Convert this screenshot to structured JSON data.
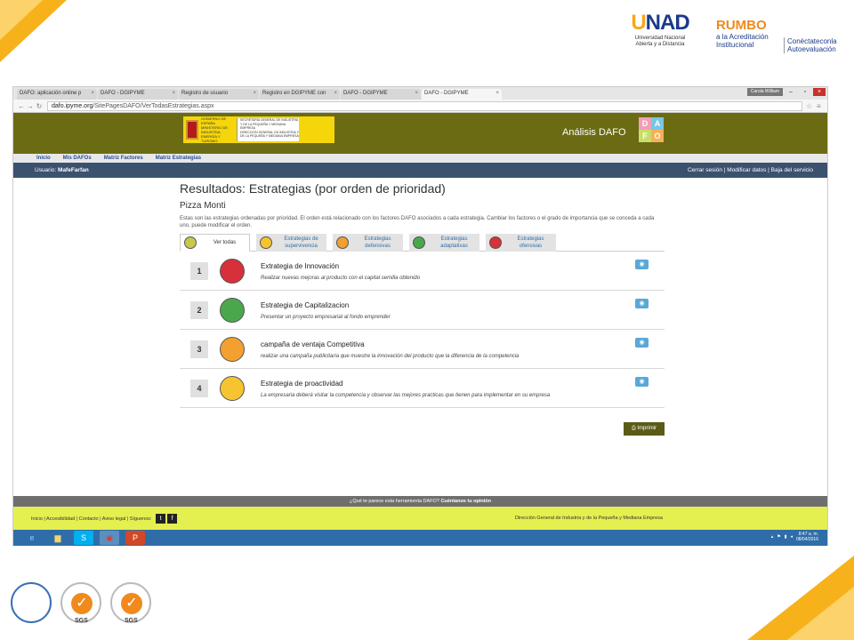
{
  "slide": {
    "unad_logo": {
      "name_letter_u": "U",
      "name_rest": "NAD",
      "line1": "Universidad Nacional",
      "line2": "Abierta y a Distancia"
    },
    "rumbo_logo": {
      "title": "RUMBO",
      "line1": "a la Acreditación",
      "line2": "Institucional",
      "side1": "Conéctateconla",
      "side2": "Autoevaluación"
    },
    "bottom_logos": [
      "SGS",
      "SGS"
    ]
  },
  "browser": {
    "tabs": [
      {
        "label": "DAFO: aplicación online p",
        "active": false
      },
      {
        "label": "DAFO - DGIPYME",
        "active": false
      },
      {
        "label": "Registro de usuario",
        "active": false
      },
      {
        "label": "Registro en DGIPYME con",
        "active": false
      },
      {
        "label": "DAFO - DGIPYME",
        "active": false
      },
      {
        "label": "DAFO - DGIPYME",
        "active": true
      }
    ],
    "user_chip": "Carola William",
    "url": "dafo.ipyme.org",
    "url_path": "/SitePagesDAFO/VerTodasEstrategias.aspx"
  },
  "header": {
    "gov_line1": "GOBIERNO DE ESPAÑA",
    "gov_line2": "MINISTERIO DE INDUSTRIA, ENERGÍA Y TURISMO",
    "gov_line3": "SECRETARÍA GENERAL DE INDUSTRIA Y DE LA PEQUEÑA Y MEDIANA EMPRESA",
    "gov_line4": "DIRECCIÓN GENERAL DE INDUSTRIA Y DE LA PEQUEÑA Y MEDIANA EMPRESA",
    "title": "Análisis DAFO",
    "logo_letters": [
      "D",
      "A",
      "F",
      "O"
    ]
  },
  "menu": [
    "Inicio",
    "Mis DAFOs",
    "Matriz Factores",
    "Matriz Estrategias"
  ],
  "userbar": {
    "user_label": "Usuario:",
    "user_name": "MafeFarfan",
    "links": "Cerrar sesión | Modificar datos | Baja del servicio"
  },
  "content": {
    "title": "Resultados: Estrategias (por orden de prioridad)",
    "company": "Pizza Monti",
    "description": "Estas son las estrategias ordenadas por prioridad. El orden está relacionado con los factores DAFO asociados a cada estrategia. Cambiar los factores o el grado de importancia que se conceda a cada uno, puede modificar el orden.",
    "filter_tabs": [
      {
        "label": "Ver todas",
        "color": "#c8c84a"
      },
      {
        "label": "Estrategias de supervivencia",
        "color": "#f5c430"
      },
      {
        "label": "Estrategias defensivas",
        "color": "#f2a030"
      },
      {
        "label": "Estrategias adaptativas",
        "color": "#4aa84a"
      },
      {
        "label": "Estrategias ofensivas",
        "color": "#d8303a"
      }
    ],
    "strategies": [
      {
        "num": "1",
        "title": "Extrategia de Innovación",
        "subtitle": "Realizar nuevas mejoras al producto con el capital semilla obtenido",
        "color": "#d8303a"
      },
      {
        "num": "2",
        "title": "Estrategia de Capitalizacion",
        "subtitle": "Presentar un proyecto empresarial al fondo emprender",
        "color": "#4aa84a"
      },
      {
        "num": "3",
        "title": "campaña de ventaja Competitiva",
        "subtitle": "realizar una campaña publicitaria que muestre la innovación del producto que la diferencia de la competencia",
        "color": "#f2a030"
      },
      {
        "num": "4",
        "title": "Estrategia de proactividad",
        "subtitle": "La empresaria deberá visitar la competencia y observar las mejores practicas que tienen para implementar en su empresa",
        "color": "#f5c430"
      }
    ],
    "print_label": "Imprimir"
  },
  "footer": {
    "question": "¿Qué te parece esta herramienta DAFO?",
    "question_link": "Cuéntanos tu opinión",
    "links": "Inicio | Accesibilidad | Contacto | Aviso legal | Síguenos:",
    "org": "Dirección General de Industria y de la Pequeña y Mediana Empresa"
  },
  "taskbar": {
    "time": "8:47 a. m.",
    "date": "08/04/2016"
  }
}
